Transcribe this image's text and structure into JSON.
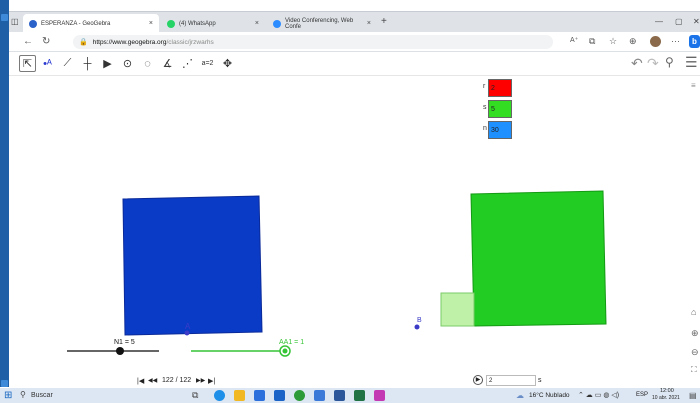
{
  "browser": {
    "tabs": [
      {
        "title": "ESPERANZA - GeoGebra",
        "close": "×",
        "icon_color": "#2a62c9"
      },
      {
        "title": "(4) WhatsApp",
        "close": "×",
        "icon_color": "#25d366"
      },
      {
        "title": "Video Conferencing, Web Confe",
        "close": "×",
        "icon_color": "#2d8cff"
      }
    ],
    "new_tab": "+",
    "window_controls": {
      "minimize": "—",
      "maximize": "▢",
      "close": "✕"
    },
    "url_host": "https://www.geogebra.org",
    "url_path": "/classic/jrzwarhs",
    "reader_label": "A⁺"
  },
  "geogebra": {
    "undo": "↶",
    "redo": "↷",
    "inputs": [
      {
        "label": "r",
        "value": "2",
        "bg": "#ff0000"
      },
      {
        "label": "s",
        "value": "5",
        "bg": "#33dd22"
      },
      {
        "label": "n",
        "value": "30",
        "bg": "#1e90ff"
      }
    ],
    "point_A": "A",
    "point_B": "B",
    "slider_N1": {
      "label": "N1 = 5",
      "value": 5
    },
    "slider_AA1": {
      "label": "AA1 = 1",
      "value": 1
    },
    "colors": {
      "blue_square": "#0a3bc6",
      "green_square": "#22cc22",
      "light_green": "#bff2a8",
      "point": "#3b3bc8",
      "slider_green": "#35c435"
    }
  },
  "bottom": {
    "first": "|◀",
    "prev": "◀◀",
    "step": "122 / 122",
    "next": "▶▶",
    "last": "▶|",
    "play": "▶",
    "speed_value": "2",
    "speed_unit": "s"
  },
  "taskbar": {
    "search": "Buscar",
    "weather": "16°C Nublado",
    "lang": "ESP",
    "time": "12:00",
    "date": "10 abr. 2021"
  }
}
